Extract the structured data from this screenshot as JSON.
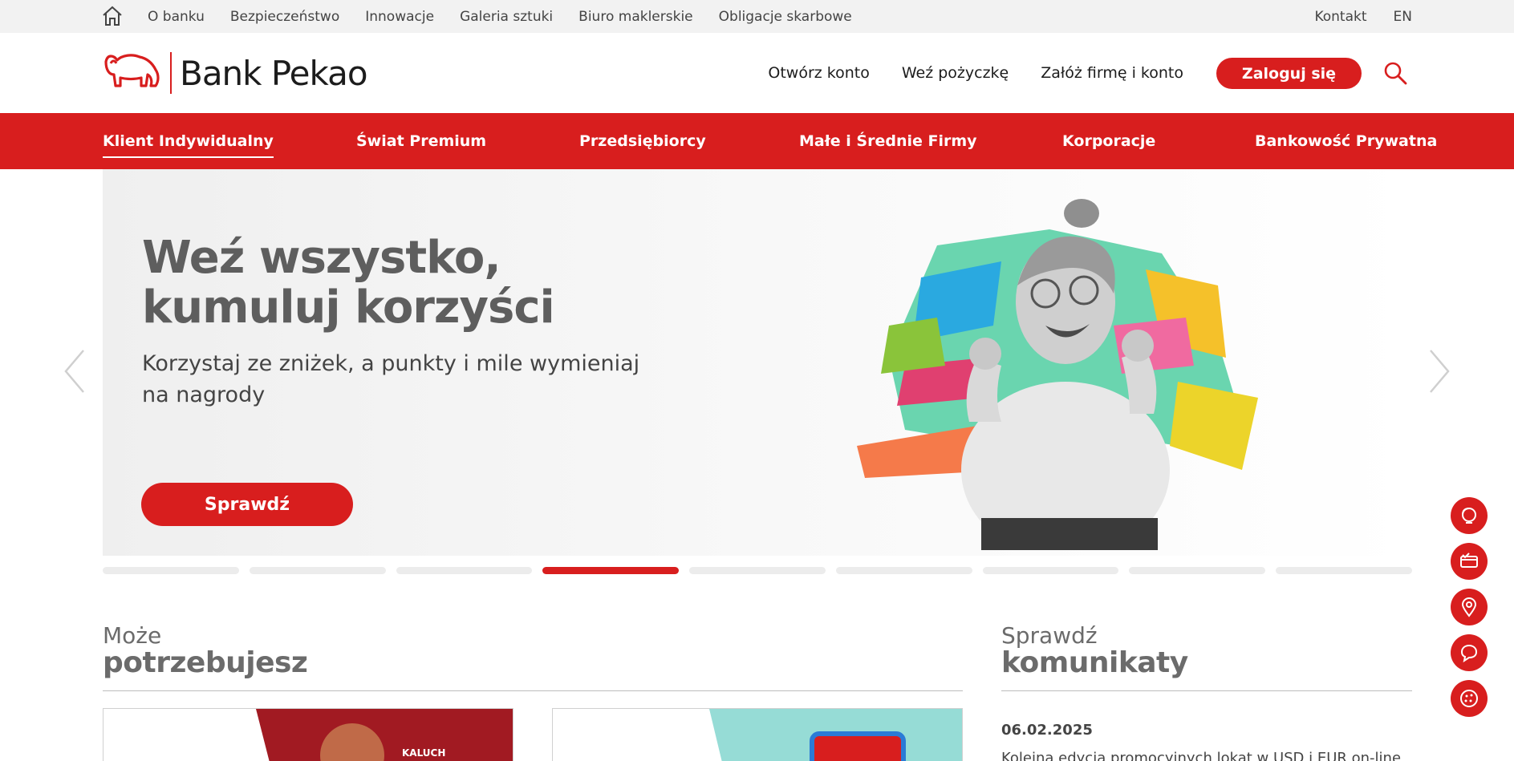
{
  "utility": {
    "links": [
      "O banku",
      "Bezpieczeństwo",
      "Innowacje",
      "Galeria sztuki",
      "Biuro maklerskie",
      "Obligacje skarbowe"
    ],
    "contact": "Kontakt",
    "language": "EN",
    "home_icon": "home-icon"
  },
  "header": {
    "brand": "Bank Pekao",
    "nav": [
      "Otwórz konto",
      "Weź pożyczkę",
      "Załóż firmę i konto"
    ],
    "login": "Zaloguj się",
    "search_icon": "search-icon"
  },
  "segments": {
    "items": [
      "Klient Indywidualny",
      "Świat Premium",
      "Przedsiębiorcy",
      "Małe i Średnie Firmy",
      "Korporacje",
      "Bankowość Prywatna"
    ],
    "active": "Klient Indywidualny"
  },
  "hero": {
    "title": "Weź wszystko, kumuluj korzyści",
    "subtitle": "Korzystaj ze zniżek, a punkty i mile wymieniaj na nagrody",
    "cta": "Sprawdź",
    "slide_count": 9,
    "active_slide": 4
  },
  "section_needs": {
    "light": "Może",
    "bold": "potrzebujesz",
    "card1_tag": "KALUCH"
  },
  "section_news": {
    "light": "Sprawdź",
    "bold": "komunikaty",
    "date": "06.02.2025",
    "text": "Kolejna edycja promocyjnych lokat w USD i EUR on-line"
  },
  "colors": {
    "brand_red": "#d81e1e",
    "utility_bg": "#f2f2f2",
    "heading_gray": "#5e5e5e"
  },
  "side_buttons": [
    "support-icon",
    "card-check-icon",
    "location-pin-icon",
    "chat-bubble-icon",
    "cookie-icon"
  ]
}
